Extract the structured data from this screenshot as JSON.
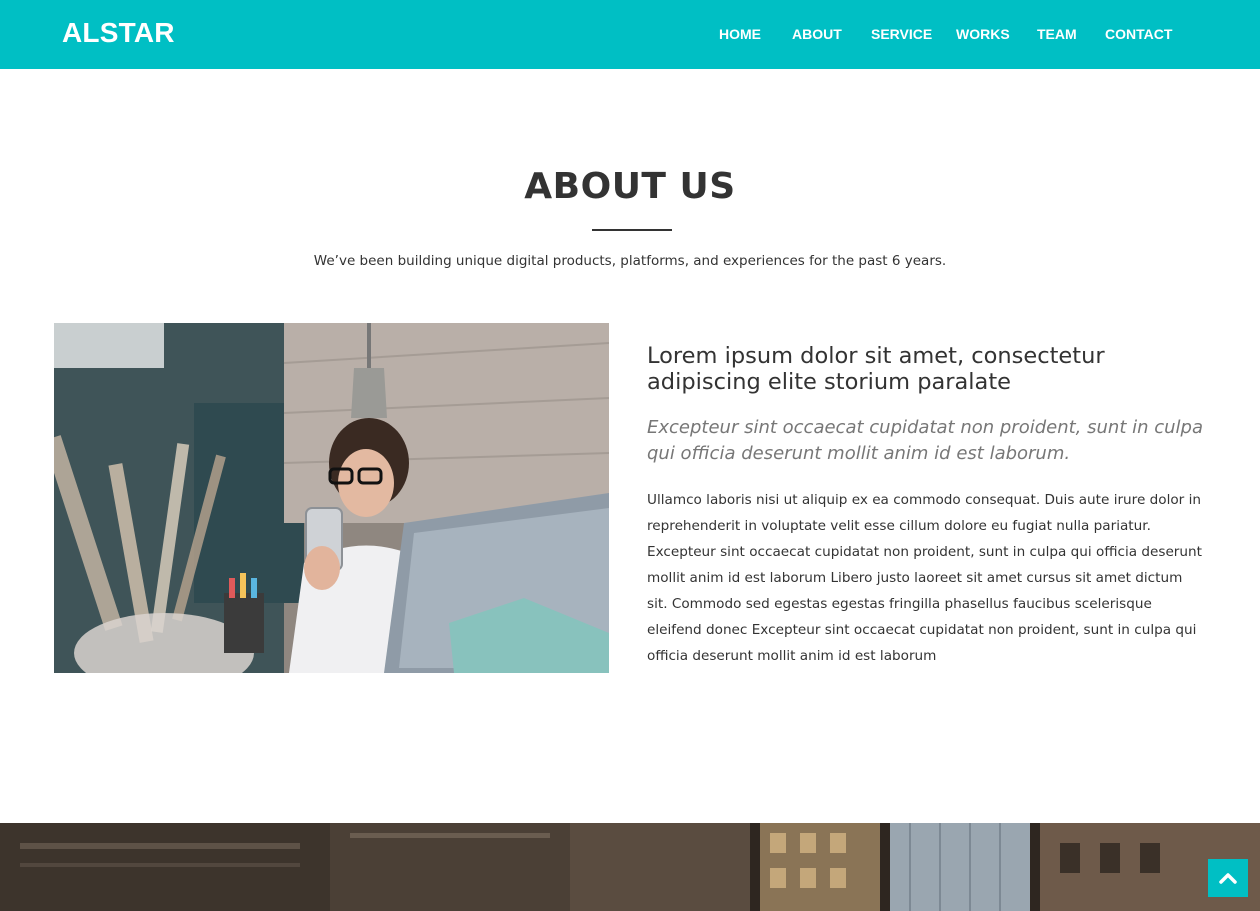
{
  "header": {
    "brand": "ALSTAR",
    "nav": [
      "HOME",
      "ABOUT",
      "SERVICE",
      "WORKS",
      "TEAM",
      "CONTACT"
    ],
    "accent_color": "#00bfc4"
  },
  "about": {
    "title": "ABOUT US",
    "subtitle": "We’ve been building unique digital products, platforms, and experiences for the past 6 years.",
    "heading": "Lorem ipsum dolor sit amet, consectetur adipiscing elite storium paralate",
    "lead": "Excepteur sint occaecat cupidatat non proident, sunt in culpa qui officia deserunt mollit anim id est laborum.",
    "body": "Ullamco laboris nisi ut aliquip ex ea commodo consequat. Duis aute irure dolor in reprehenderit in voluptate velit esse cillum dolore eu fugiat nulla pariatur. Excepteur sint occaecat cupidatat non proident, sunt in culpa qui officia deserunt mollit anim id est laborum Libero justo laoreet sit amet cursus sit amet dictum sit. Commodo sed egestas egestas fringilla phasellus faucibus scelerisque eleifend donec Excepteur sint occaecat cupidatat non proident, sunt in culpa qui officia deserunt mollit anim id est laborum",
    "photo_icon": "woman-with-phone-and-laptop-photo"
  },
  "banner": {
    "image": "city-buildings-photo"
  },
  "back_to_top": {
    "icon": "chevron-up-icon"
  }
}
